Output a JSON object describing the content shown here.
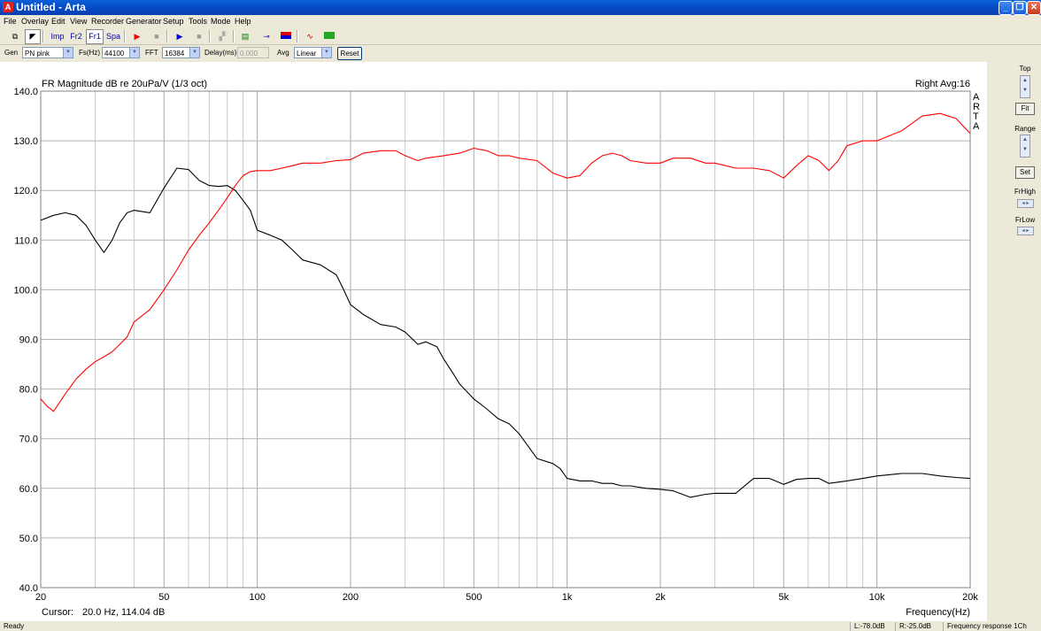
{
  "window": {
    "title": "Untitled - Arta",
    "app_icon": "arta-app-icon"
  },
  "menu": [
    "File",
    "Overlay",
    "Edit",
    "View",
    "Recorder",
    "Generator",
    "Setup",
    "Tools",
    "Mode",
    "Help"
  ],
  "toolbar": {
    "buttons": [
      {
        "name": "copy-button",
        "label": "",
        "icon": "copy-icon"
      },
      {
        "name": "cursor-button",
        "label": "",
        "icon": "cursor-icon"
      },
      {
        "name": "imp-button",
        "label": "Imp",
        "icon": ""
      },
      {
        "name": "fr2-button",
        "label": "Fr2",
        "icon": ""
      },
      {
        "name": "fr1-button",
        "label": "Fr1",
        "icon": ""
      },
      {
        "name": "spa-button",
        "label": "Spa",
        "icon": ""
      },
      {
        "name": "record-button",
        "label": "",
        "icon": "play-red-icon"
      },
      {
        "name": "stop-record-button",
        "label": "",
        "icon": "stop-icon"
      },
      {
        "name": "play-button",
        "label": "",
        "icon": "play-blue-icon"
      },
      {
        "name": "stop-play-button",
        "label": "",
        "icon": "stop-icon"
      },
      {
        "name": "rec-disabled-button",
        "label": "",
        "icon": "rec-icon"
      },
      {
        "name": "overlay-button",
        "label": "",
        "icon": "overlay-icon"
      },
      {
        "name": "marker-button",
        "label": "",
        "icon": "marker-icon"
      },
      {
        "name": "colors-button",
        "label": "",
        "icon": "colors-icon"
      },
      {
        "name": "curve-button",
        "label": "",
        "icon": "curve-icon"
      },
      {
        "name": "graph-button",
        "label": "",
        "icon": "graph-icon"
      }
    ]
  },
  "options": {
    "gen_label": "Gen",
    "gen_value": "PN pink",
    "fs_label": "Fs(Hz)",
    "fs_value": "44100",
    "fft_label": "FFT",
    "fft_value": "16384",
    "delay_label": "Delay(ms)",
    "delay_value": "0.000",
    "avg_label": "Avg",
    "avg_value": "Linear",
    "reset_label": "Reset"
  },
  "right_panel": {
    "top_label": "Top",
    "fit_label": "Fit",
    "range_label": "Range",
    "set_label": "Set",
    "frhigh_label": "FrHigh",
    "frlow_label": "FrLow"
  },
  "status": {
    "ready": "Ready",
    "left_level": "L:-78.0dB",
    "right_level": "R:-25.0dB",
    "mode": "Frequency response 1Ch"
  },
  "plot": {
    "side_text": [
      "A",
      "R",
      "T",
      "A"
    ],
    "cursor_label": "Cursor:",
    "cursor_value": "20.0 Hz, 114.04 dB",
    "channel_info": "Right  Avg:16"
  },
  "colors": {
    "trace_black": "#000000",
    "trace_red": "#ff0000",
    "grid": "#b4b4b4",
    "titlebar": "#0548c2"
  },
  "chart_data": {
    "type": "line",
    "title": "FR Magnitude dB re 20uPa/V (1/3 oct)",
    "xlabel": "Frequency(Hz)",
    "ylabel": "",
    "xscale": "log",
    "xlim": [
      20,
      20000
    ],
    "ylim": [
      40,
      140
    ],
    "x_ticks": [
      20,
      50,
      100,
      200,
      500,
      1000,
      2000,
      5000,
      10000,
      20000
    ],
    "x_tick_labels": [
      "20",
      "50",
      "100",
      "200",
      "500",
      "1k",
      "2k",
      "5k",
      "10k",
      "20k"
    ],
    "y_ticks": [
      40,
      50,
      60,
      70,
      80,
      90,
      100,
      110,
      120,
      130,
      140
    ],
    "y_tick_labels": [
      "40.0",
      "50.0",
      "60.0",
      "70.0",
      "80.0",
      "90.0",
      "100.0",
      "110.0",
      "120.0",
      "130.0",
      "140.0"
    ],
    "grid": true,
    "series": [
      {
        "color": "#000000",
        "x": [
          20,
          22,
          24,
          26,
          28,
          30,
          32,
          34,
          36,
          38,
          40,
          45,
          50,
          55,
          60,
          65,
          70,
          75,
          80,
          85,
          90,
          95,
          100,
          110,
          120,
          130,
          140,
          160,
          180,
          190,
          200,
          220,
          250,
          280,
          300,
          330,
          350,
          380,
          400,
          430,
          450,
          500,
          550,
          600,
          650,
          700,
          800,
          900,
          950,
          1000,
          1100,
          1200,
          1300,
          1400,
          1500,
          1600,
          1800,
          2000,
          2200,
          2500,
          2800,
          3000,
          3500,
          4000,
          4500,
          5000,
          5500,
          6000,
          6500,
          7000,
          8000,
          9000,
          10000,
          12000,
          14000,
          16000,
          18000,
          20000
        ],
        "values": [
          114,
          115,
          115.5,
          115,
          113,
          110,
          107.5,
          110,
          113.5,
          115.5,
          116,
          115.5,
          120.5,
          124.5,
          124.2,
          122,
          121,
          120.8,
          121,
          120,
          118,
          116,
          112,
          111,
          110,
          108,
          106,
          105,
          103,
          100,
          97,
          95,
          93,
          92.5,
          91.5,
          89,
          89.5,
          88.5,
          86,
          83,
          81,
          78,
          76,
          74,
          73,
          71,
          66,
          65,
          64,
          62,
          61.5,
          61.5,
          61,
          61,
          60.5,
          60.5,
          60,
          59.8,
          59.5,
          58.2,
          58.8,
          59,
          59,
          62,
          62,
          60.8,
          61.8,
          62,
          62,
          61,
          61.5,
          62,
          62.5,
          63,
          63,
          62.5,
          62.2,
          62
        ]
      },
      {
        "color": "#ff0000",
        "x": [
          20,
          21,
          22,
          24,
          26,
          28,
          30,
          32,
          34,
          36,
          38,
          40,
          45,
          50,
          55,
          60,
          65,
          70,
          75,
          80,
          85,
          90,
          95,
          100,
          110,
          120,
          130,
          140,
          160,
          180,
          200,
          220,
          250,
          280,
          300,
          330,
          350,
          400,
          450,
          500,
          550,
          600,
          650,
          700,
          800,
          900,
          1000,
          1100,
          1200,
          1300,
          1400,
          1500,
          1600,
          1800,
          2000,
          2200,
          2500,
          2800,
          3000,
          3500,
          4000,
          4500,
          5000,
          5500,
          6000,
          6500,
          7000,
          7500,
          8000,
          9000,
          10000,
          12000,
          14000,
          16000,
          18000,
          20000
        ],
        "values": [
          78,
          76.5,
          75.5,
          79,
          82,
          84,
          85.5,
          86.5,
          87.5,
          89,
          90.5,
          93.5,
          96,
          100,
          104,
          108,
          111,
          113.5,
          116,
          118.5,
          121,
          123,
          123.8,
          124,
          124,
          124.5,
          125,
          125.5,
          125.5,
          126,
          126.2,
          127.5,
          128,
          128,
          127,
          126,
          126.5,
          127,
          127.5,
          128.5,
          128,
          127,
          127,
          126.5,
          126,
          123.5,
          122.5,
          123,
          125.5,
          127,
          127.5,
          127,
          126,
          125.5,
          125.5,
          126.5,
          126.5,
          125.5,
          125.5,
          124.5,
          124.5,
          124,
          122.5,
          125,
          127,
          126,
          124,
          126,
          129,
          130,
          130,
          132,
          135,
          135.5,
          134.5,
          131.5
        ]
      }
    ]
  }
}
